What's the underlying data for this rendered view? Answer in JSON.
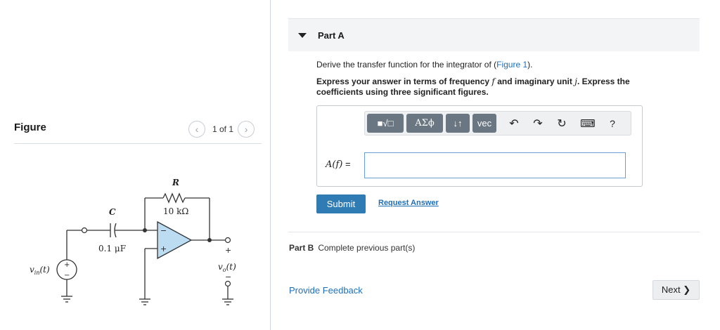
{
  "figure": {
    "title": "Figure",
    "pager": {
      "text": "1 of 1",
      "prev": "‹",
      "next": "›"
    },
    "circuit": {
      "resistor_symbol": "R",
      "resistor_value": "10 kΩ",
      "capacitor_symbol": "C",
      "capacitor_value": "0.1 μF",
      "source_label": "v",
      "source_sub": "in",
      "source_arg": "(t)",
      "output_label": "v",
      "output_sub": "o",
      "output_arg": "(t)",
      "plus": "+",
      "minus": "−"
    }
  },
  "part_a": {
    "title": "Part A",
    "question_prefix": "Derive the transfer function for the integrator of (",
    "question_link": "Figure 1",
    "question_suffix": ").",
    "instruction_1": "Express your answer in terms of frequency ",
    "instruction_f": "f",
    "instruction_2": " and imaginary unit ",
    "instruction_j": "j",
    "instruction_3": ". Express the coefficients using three significant figures.",
    "toolbar": {
      "templates_icon": "■√□",
      "greek_label": "ΑΣϕ",
      "arrows_label": "↓↑",
      "vec_label": "vec",
      "undo": "↶",
      "redo": "↷",
      "reset": "↻",
      "keyboard": "⌨",
      "help": "?"
    },
    "answer_label": "A(f)",
    "answer_eq": " =",
    "answer_value": "",
    "submit_label": "Submit",
    "request_label": "Request Answer"
  },
  "part_b": {
    "title": "Part B",
    "status": "Complete previous part(s)"
  },
  "feedback_label": "Provide Feedback",
  "next_label": "Next ❯"
}
